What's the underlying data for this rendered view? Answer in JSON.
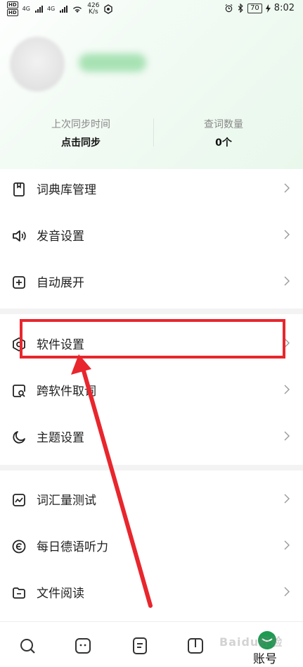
{
  "status_bar": {
    "hd1": "HD",
    "hd2": "HD",
    "net1": "4G",
    "net2": "4G",
    "speed_value": "426",
    "speed_unit": "K/s",
    "battery": "70",
    "time": "8:02"
  },
  "sync": {
    "last_sync_label": "上次同步时间",
    "last_sync_value": "点击同步",
    "lookup_count_label": "查词数量",
    "lookup_count_value": "0个"
  },
  "menu": {
    "items": [
      {
        "label": "词典库管理",
        "icon": "book-icon"
      },
      {
        "label": "发音设置",
        "icon": "speaker-icon"
      },
      {
        "label": "自动展开",
        "icon": "plus-square-icon"
      },
      {
        "label": "软件设置",
        "icon": "hexagon-gear-icon"
      },
      {
        "label": "跨软件取词",
        "icon": "search-doc-icon"
      },
      {
        "label": "主题设置",
        "icon": "moon-icon"
      },
      {
        "label": "词汇量测试",
        "icon": "chart-icon"
      },
      {
        "label": "每日德语听力",
        "icon": "circle-c-icon"
      },
      {
        "label": "文件阅读",
        "icon": "folder-icon"
      }
    ]
  },
  "bottom_nav": {
    "active_label": "账号",
    "watermark": "Baidu经验"
  },
  "colors": {
    "accent": "#1f9a52",
    "highlight": "#e8262d"
  }
}
